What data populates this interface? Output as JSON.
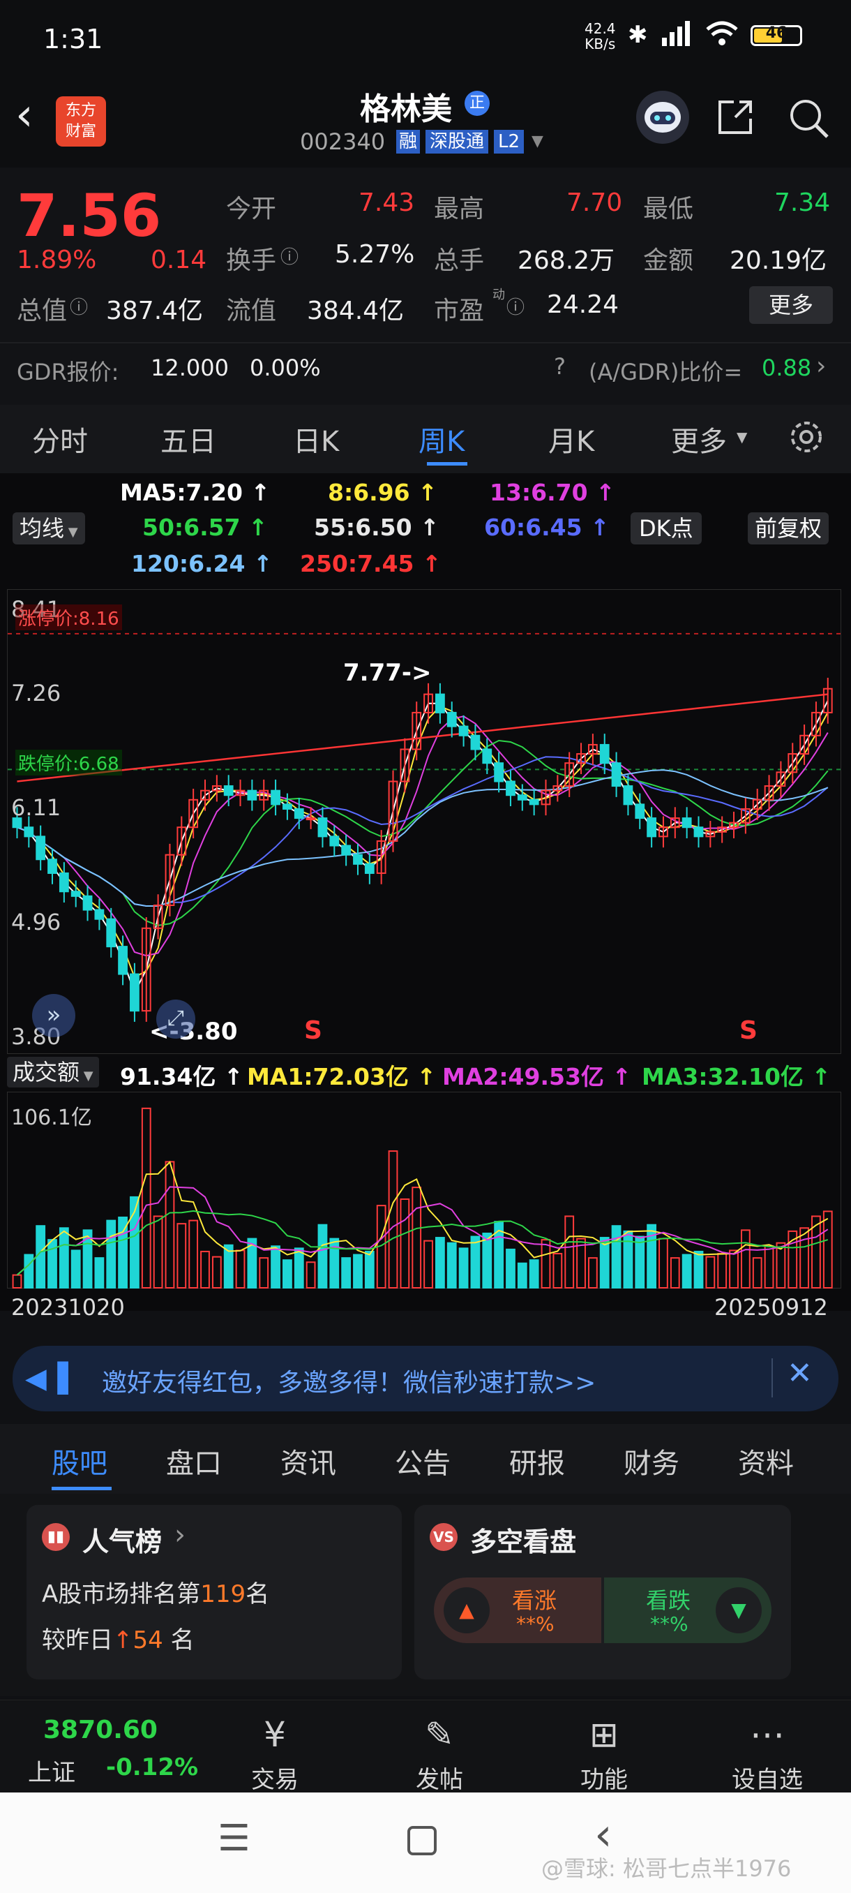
{
  "status": {
    "time": "1:31",
    "net_speed": "42.4",
    "net_unit": "KB/s",
    "battery": "46"
  },
  "header": {
    "title": "格林美",
    "badge": "正",
    "code": "002340",
    "tags": [
      "融",
      "深股通",
      "L2"
    ],
    "logo_line1": "东方",
    "logo_line2": "财富"
  },
  "quote": {
    "price": "7.56",
    "change_pct": "1.89%",
    "change_amt": "0.14",
    "fields": [
      {
        "label": "今开",
        "value": "7.43"
      },
      {
        "label": "最高",
        "value": "7.70"
      },
      {
        "label": "最低",
        "value": "7.34"
      },
      {
        "label": "换手",
        "value": "5.27%"
      },
      {
        "label": "总手",
        "value": "268.2万"
      },
      {
        "label": "金额",
        "value": "20.19亿"
      },
      {
        "label": "总值",
        "value": "387.4亿"
      },
      {
        "label": "流值",
        "value": "384.4亿"
      },
      {
        "label": "市盈",
        "value": "24.24"
      }
    ],
    "pe_sup": "动",
    "more_button": "更多",
    "gdr_label": "GDR报价:",
    "gdr_price": "12.000",
    "gdr_pct": "0.00%",
    "gdr_ratio_label": "(A/GDR)比价=",
    "gdr_ratio": "0.88"
  },
  "tabs": [
    "分时",
    "五日",
    "日K",
    "周K",
    "月K",
    "更多"
  ],
  "active_tab": "周K",
  "ma_row": {
    "selector": "均线",
    "items": [
      {
        "text": "MA5:7.20 ↑",
        "color": "#ffffff"
      },
      {
        "text": "8:6.96 ↑",
        "color": "#ffe93b"
      },
      {
        "text": "13:6.70 ↑",
        "color": "#e040e0"
      },
      {
        "text": "50:6.57 ↑",
        "color": "#2ed64a"
      },
      {
        "text": "55:6.50 ↑",
        "color": "#e8e8e8"
      },
      {
        "text": "60:6.45 ↑",
        "color": "#5a6cff"
      },
      {
        "text": "120:6.24 ↑",
        "color": "#7cc2ff"
      },
      {
        "text": "250:7.45 ↑",
        "color": "#ff3535"
      }
    ],
    "dk_button": "DK点",
    "fq_button": "前复权"
  },
  "chart_data": {
    "type": "candlestick",
    "period": "weekly",
    "x_start": "20231020",
    "x_end": "20250912",
    "y_labels": [
      "8.41",
      "7.26",
      "6.11",
      "4.96",
      "3.80"
    ],
    "ylim": [
      3.8,
      8.41
    ],
    "limit_up": "涨停价:8.16",
    "limit_down": "跌停价:6.68",
    "limit_up_value": 8.16,
    "limit_down_value": 6.68,
    "annot_high": "7.77->",
    "annot_low": "<-3.80",
    "sell_marks": [
      "S",
      "S"
    ],
    "close": [
      6.05,
      5.95,
      5.7,
      5.55,
      5.35,
      5.3,
      5.15,
      5.05,
      4.75,
      4.45,
      4.05,
      4.95,
      5.2,
      5.75,
      6.05,
      6.35,
      6.45,
      6.5,
      6.4,
      6.45,
      6.35,
      6.45,
      6.3,
      6.25,
      6.15,
      6.15,
      5.95,
      5.85,
      5.75,
      5.65,
      5.55,
      5.9,
      6.55,
      6.9,
      7.3,
      7.5,
      7.3,
      7.15,
      7.05,
      6.9,
      6.75,
      6.55,
      6.4,
      6.35,
      6.3,
      6.45,
      6.5,
      6.75,
      6.85,
      6.95,
      6.75,
      6.5,
      6.3,
      6.15,
      5.95,
      6.05,
      6.15,
      6.05,
      5.95,
      6.0,
      6.05,
      6.1,
      6.25,
      6.35,
      6.5,
      6.65,
      6.85,
      7.05,
      7.3,
      7.56
    ],
    "volume": {
      "label": "成交额",
      "value": "91.34亿 ↑",
      "ma1": "MA1:72.03亿 ↑",
      "ma2": "MA2:49.53亿 ↑",
      "ma3": "MA3:32.10亿 ↑",
      "ymax_label": "106.1亿"
    }
  },
  "banner": {
    "text": "邀好友得红包，多邀多得！微信秒速打款>>"
  },
  "bottom_tabs": [
    "股吧",
    "盘口",
    "资讯",
    "公告",
    "研报",
    "财务",
    "资料"
  ],
  "card1": {
    "title": "人气榜",
    "line1_pre": "A股市场排名第",
    "rank": "119",
    "line1_post": "名",
    "line2_pre": "较昨日",
    "delta": "54",
    "line2_post": "名"
  },
  "card2": {
    "title": "多空看盘",
    "up_label": "看涨",
    "up_val": "**%",
    "down_label": "看跌",
    "down_val": "**%"
  },
  "nav": {
    "index_value": "3870.60",
    "index_name": "上证",
    "index_change": "-0.12%",
    "items": [
      "交易",
      "发帖",
      "功能",
      "设自选"
    ]
  },
  "watermark": "@雪球: 松哥七点半1976"
}
